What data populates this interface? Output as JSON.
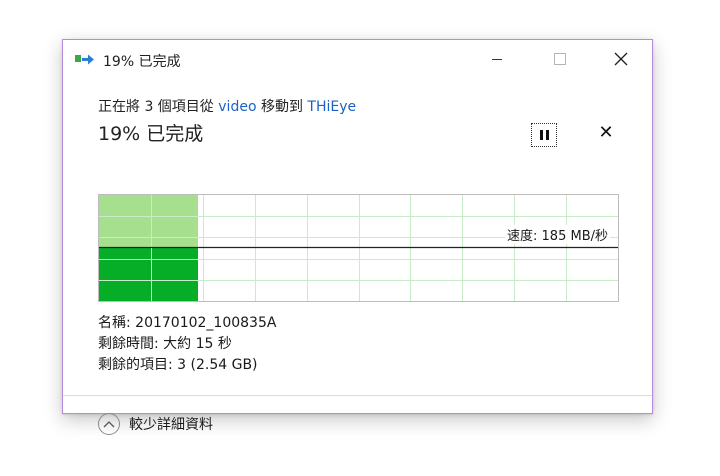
{
  "window": {
    "title": "19% 已完成",
    "border_color": "#b58be0"
  },
  "titlebar": {
    "minimize_icon": "minimize-icon",
    "maximize_icon": "maximize-icon",
    "close_icon": "close-icon"
  },
  "operation": {
    "prefix": "正在將 3 個項目從 ",
    "source": "video",
    "middle": " 移動到 ",
    "destination": "THiEye",
    "link_color": "#1a62c5"
  },
  "status": {
    "percent_text": "19% 已完成",
    "progress_fraction": 0.19
  },
  "controls": {
    "pause_icon": "pause-icon",
    "cancel_icon": "cancel-icon"
  },
  "graph": {
    "speed_label": "速度: 185 MB/秒",
    "colors": {
      "grid": "#c8ecc8",
      "fill_light": "#a6e08e",
      "fill_dark": "#06ae28",
      "speed_line": "#222222"
    }
  },
  "details": {
    "name": "名稱: 20170102_100835A",
    "time_remaining": "剩餘時間: 大約 15 秒",
    "items_remaining": "剩餘的項目: 3 (2.54 GB)"
  },
  "footer": {
    "fewer_details_label": "較少詳細資料",
    "chevron_icon": "chevron-up-icon"
  }
}
